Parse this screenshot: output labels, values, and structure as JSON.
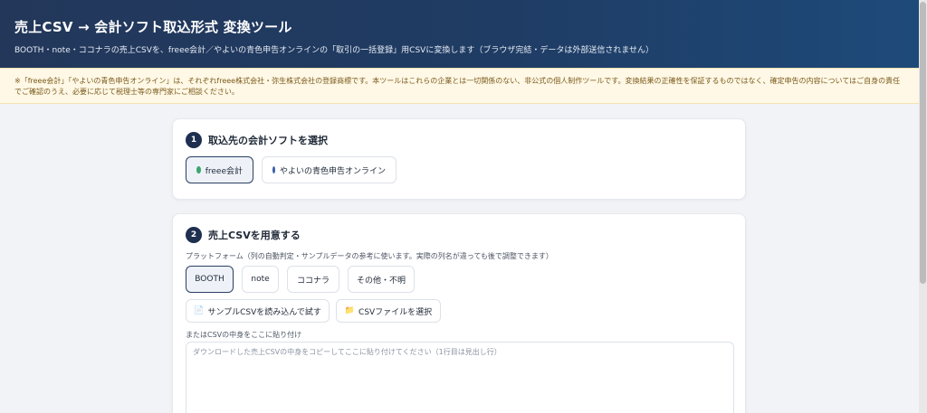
{
  "header": {
    "title": "売上CSV → 会計ソフト取込形式 変換ツール",
    "subtitle": "BOOTH・note・ココナラの売上CSVを、freee会計／やよいの青色申告オンラインの「取引の一括登録」用CSVに変換します（ブラウザ完結・データは外部送信されません）"
  },
  "notice": {
    "text": "※「freee会計」「やよいの青色申告オンライン」は、それぞれfreee株式会社・弥生株式会社の登録商標です。本ツールはこれらの企業とは一切関係のない、非公式の個人制作ツールです。変換結果の正確性を保証するものではなく、確定申告の内容についてはご自身の責任でご確認のうえ、必要に応じて税理士等の専門家にご相談ください。"
  },
  "step1": {
    "number": "1",
    "title": "取込先の会計ソフトを選択",
    "options": [
      {
        "label": "freee会計",
        "dot_color": "#3aa76d",
        "selected": true
      },
      {
        "label": "やよいの青色申告オンライン",
        "dot_color": "#3b5ea8",
        "selected": false
      }
    ]
  },
  "step2": {
    "number": "2",
    "title": "売上CSVを用意する",
    "platform_label": "プラットフォーム（列の自動判定・サンプルデータの参考に使います。実際の列名が違っても後で調整できます）",
    "platforms": [
      {
        "label": "BOOTH",
        "selected": true
      },
      {
        "label": "note",
        "selected": false
      },
      {
        "label": "ココナラ",
        "selected": false
      },
      {
        "label": "その他・不明",
        "selected": false
      }
    ],
    "sample_button": "サンプルCSVを読み込んで試す",
    "file_button": "CSVファイルを選択",
    "paste_label": "またはCSVの中身をここに貼り付け",
    "paste_placeholder": "ダウンロードした売上CSVの中身をコピーしてここに貼り付けてください（1行目は見出し行）"
  },
  "colors": {
    "header_bg": "#1f3c64",
    "notice_bg": "#fff8e6",
    "accent": "#1e2f4f"
  }
}
